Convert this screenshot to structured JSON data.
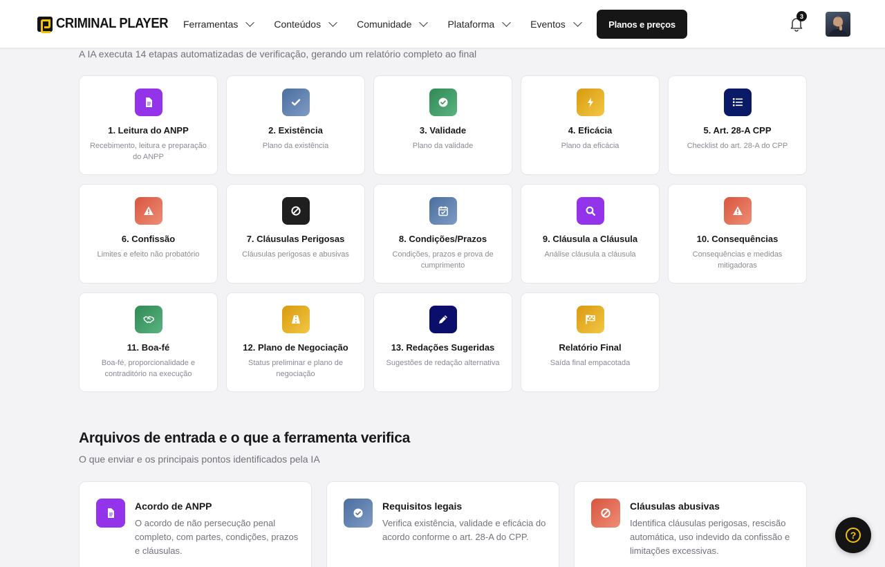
{
  "brand": {
    "name": "CRIMINAL PLAYER"
  },
  "nav": {
    "items": [
      {
        "label": "Ferramentas"
      },
      {
        "label": "Conteúdos"
      },
      {
        "label": "Comunidade"
      },
      {
        "label": "Plataforma"
      },
      {
        "label": "Eventos"
      }
    ],
    "cta_label": "Planos e preços",
    "notifications_count": "3"
  },
  "steps_section": {
    "subtitle": "A IA executa 14 etapas automatizadas de verificação, gerando um relatório completo ao final",
    "steps": [
      {
        "title": "1. Leitura do ANPP",
        "desc": "Recebimento, leitura e preparação do ANPP",
        "icon": "document-icon",
        "color": "#9333ea"
      },
      {
        "title": "2. Existência",
        "desc": "Plano da existência",
        "icon": "check-icon",
        "color": "#5b7aa8"
      },
      {
        "title": "3. Validade",
        "desc": "Plano da validade",
        "icon": "check-circle-icon",
        "color": "#3f9a63"
      },
      {
        "title": "4. Eficácia",
        "desc": "Plano da eficácia",
        "icon": "bolt-icon",
        "color": "#e0a817"
      },
      {
        "title": "5. Art. 28-A CPP",
        "desc": "Checklist do art. 28-A do CPP",
        "icon": "list-icon",
        "color": "#0b1a66"
      },
      {
        "title": "6. Confissão",
        "desc": "Limites e efeito não probatório",
        "icon": "warning-icon",
        "color": "#e06a55"
      },
      {
        "title": "7. Cláusulas Perigosas",
        "desc": "Cláusulas perigosas e abusivas",
        "icon": "ban-icon",
        "color": "#1f1f1f"
      },
      {
        "title": "8. Condições/Prazos",
        "desc": "Condições, prazos e prova de cumprimento",
        "icon": "calendar-check-icon",
        "color": "#5b7aa8"
      },
      {
        "title": "9. Cláusula a Cláusula",
        "desc": "Análise cláusula a cláusula",
        "icon": "search-icon",
        "color": "#9333ea"
      },
      {
        "title": "10. Consequências",
        "desc": "Consequências e medidas mitigadoras",
        "icon": "warning-icon",
        "color": "#e06a55"
      },
      {
        "title": "11. Boa-fé",
        "desc": "Boa-fé, proporcionalidade e contraditório na execução",
        "icon": "handshake-icon",
        "color": "#3f9a63"
      },
      {
        "title": "12. Plano de Negociação",
        "desc": "Status preliminar e plano de negociação",
        "icon": "road-icon",
        "color": "#e0a817"
      },
      {
        "title": "13. Redações Sugeridas",
        "desc": "Sugestões de redação alternativa",
        "icon": "pencil-icon",
        "color": "#0b1a66"
      },
      {
        "title": "Relatório Final",
        "desc": "Saída final empacotada",
        "icon": "flag-checkered-icon",
        "color": "#e0a817"
      }
    ]
  },
  "inputs_section": {
    "title": "Arquivos de entrada e o que a ferramenta verifica",
    "subtitle": "O que enviar e os principais pontos identificados pela IA",
    "cards": [
      {
        "title": "Acordo de ANPP",
        "desc": "O acordo de não persecução penal completo, com partes, condições, prazos e cláusulas.",
        "icon": "document-icon",
        "color": "#9333ea"
      },
      {
        "title": "Requisitos legais",
        "desc": "Verifica existência, validade e eficácia do acordo conforme o art. 28-A do CPP.",
        "icon": "check-circle-icon",
        "color": "#5b7aa8"
      },
      {
        "title": "Cláusulas abusivas",
        "desc": "Identifica cláusulas perigosas, rescisão automática, uso indevido da confissão e limitações excessivas.",
        "icon": "ban-icon",
        "color": "#e06a55"
      }
    ]
  },
  "help": {
    "label": "?"
  }
}
